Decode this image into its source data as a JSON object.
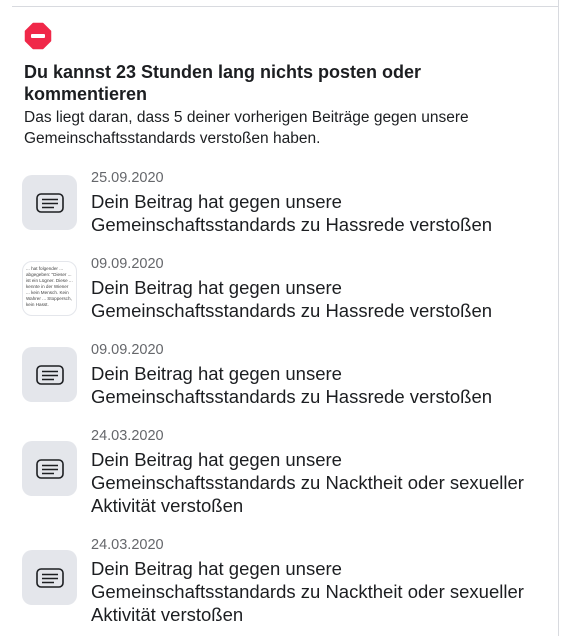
{
  "notice": {
    "icon": "block-icon",
    "accent_color": "#f02849",
    "headline": "Du kannst 23 Stunden lang nichts posten oder kommentieren",
    "subtext": "Das liegt daran, dass 5 deiner vorherigen Beiträge gegen unsere Gemeinschaftsstandards verstoßen haben."
  },
  "violations": [
    {
      "date": "25.09.2020",
      "title": "Dein Beitrag hat gegen unsere Gemeinschaftsstandards zu Hassrede verstoßen",
      "thumb": "document-icon"
    },
    {
      "date": "09.09.2020",
      "title": "Dein Beitrag hat gegen unsere Gemeinschaftsstandards zu Hassrede verstoßen",
      "thumb": "post-preview",
      "preview_text": "... hat folgender ... abgegeben: \"Dieser ... ist ein Lügner. Diese ... kennte in der Wiener ... kein Mensch. Kein Wahrer ... Stoppersch, kein Hasst."
    },
    {
      "date": "09.09.2020",
      "title": "Dein Beitrag hat gegen unsere Gemeinschaftsstandards zu Hassrede verstoßen",
      "thumb": "document-icon"
    },
    {
      "date": "24.03.2020",
      "title": "Dein Beitrag hat gegen unsere Gemeinschaftsstandards zu Nacktheit oder sexueller Aktivität verstoßen",
      "thumb": "document-icon"
    },
    {
      "date": "24.03.2020",
      "title": "Dein Beitrag hat gegen unsere Gemeinschaftsstandards zu Nacktheit oder sexueller Aktivität verstoßen",
      "thumb": "document-icon"
    }
  ]
}
